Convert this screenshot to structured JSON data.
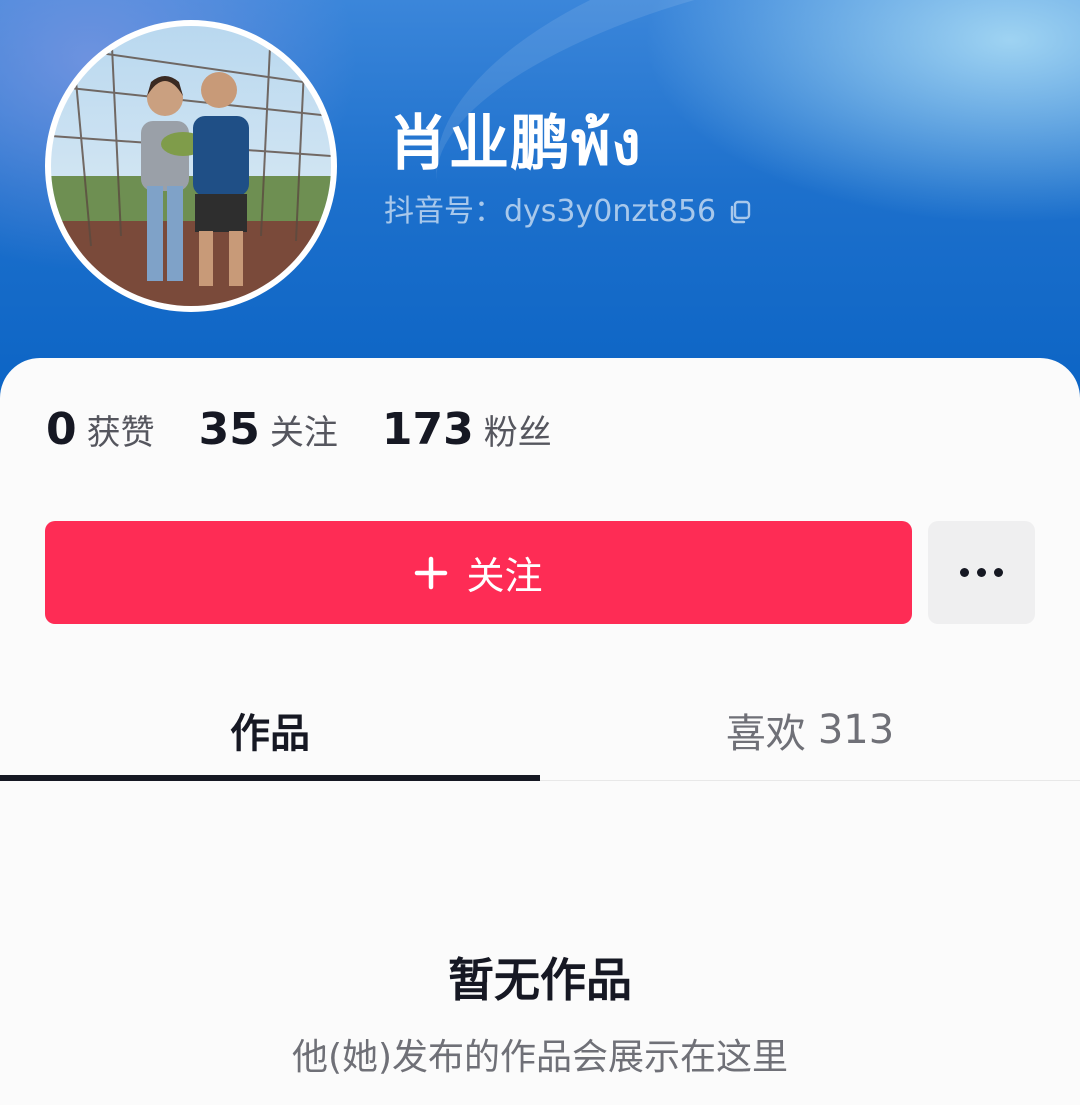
{
  "profile": {
    "name": "肖业鹏พ้ง",
    "handle_label": "抖音号：",
    "handle": "dys3y0nzt856"
  },
  "stats": [
    {
      "value": "0",
      "label": "获赞"
    },
    {
      "value": "35",
      "label": "关注"
    },
    {
      "value": "173",
      "label": "粉丝"
    }
  ],
  "actions": {
    "follow_label": "关注",
    "follow_icon": "plus-icon",
    "more_icon": "more-dots-icon"
  },
  "tabs": [
    {
      "label": "作品",
      "count": "",
      "active": true
    },
    {
      "label": "喜欢",
      "count": "313",
      "active": false
    }
  ],
  "empty_state": {
    "title": "暂无作品",
    "subtitle": "他(她)发布的作品会展示在这里"
  },
  "colors": {
    "accent": "#fe2c55",
    "header_blue": "#1d70cc",
    "text_primary": "#161823",
    "text_secondary": "#6f7077"
  }
}
